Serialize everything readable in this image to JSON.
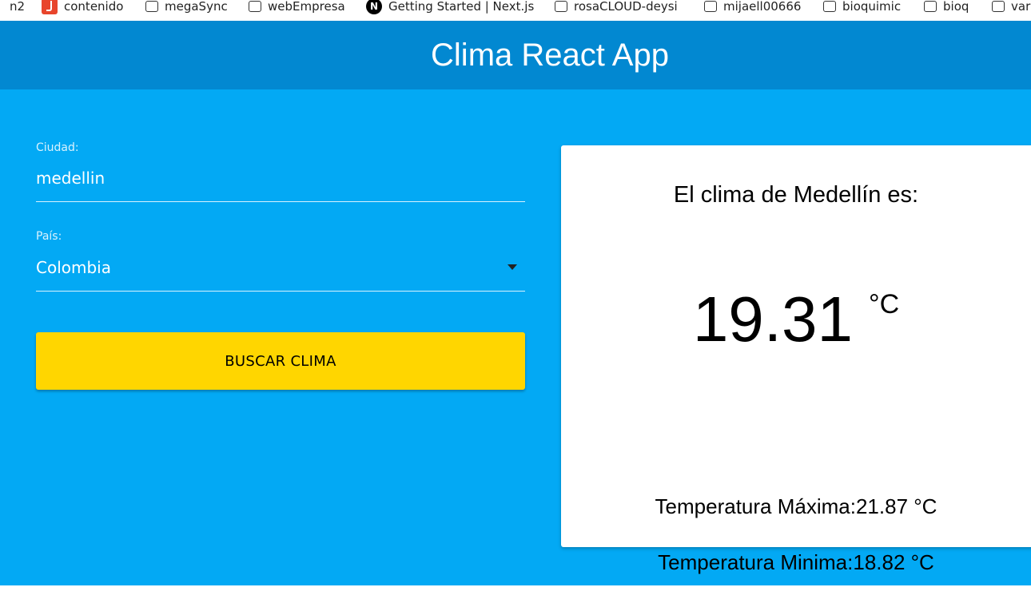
{
  "bookmarks": [
    {
      "label": "n2",
      "icon": "none"
    },
    {
      "label": "contenido",
      "icon": "red-app-icon"
    },
    {
      "label": "megaSync",
      "icon": "folder-icon"
    },
    {
      "label": "webEmpresa",
      "icon": "folder-icon"
    },
    {
      "label": "Getting Started | Next.js",
      "icon": "nextjs-icon"
    },
    {
      "label": "rosaCLOUD-deysi",
      "icon": "folder-icon"
    },
    {
      "label": "mijaell00666",
      "icon": "folder-icon"
    },
    {
      "label": "bioquimic",
      "icon": "folder-icon"
    },
    {
      "label": "bioq",
      "icon": "folder-icon"
    },
    {
      "label": "var",
      "icon": "folder-icon"
    }
  ],
  "header": {
    "title": "Clima React App",
    "background": "#0288d1"
  },
  "form": {
    "city_label": "Ciudad:",
    "city_value": "medellin",
    "country_label": "País:",
    "country_value": "Colombia",
    "submit_label": "BUSCAR CLIMA",
    "background": "#03a9f4",
    "button_color": "#ffd600"
  },
  "result": {
    "title": "El clima de Medellín es:",
    "temperature": "19.31",
    "unit": "°C",
    "max_text": "Temperatura Máxima:21.87 °C",
    "min_text": "Temperatura Minima:18.82 °C"
  }
}
